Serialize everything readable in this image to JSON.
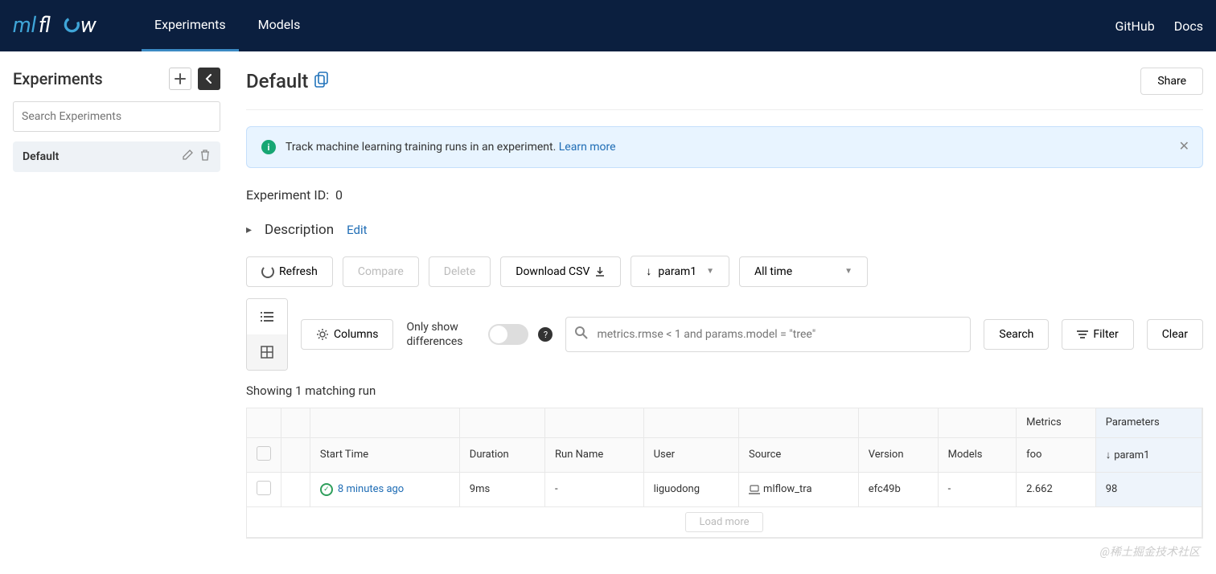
{
  "header": {
    "nav": {
      "experiments": "Experiments",
      "models": "Models"
    },
    "links": {
      "github": "GitHub",
      "docs": "Docs"
    }
  },
  "sidebar": {
    "title": "Experiments",
    "search_placeholder": "Search Experiments",
    "items": [
      {
        "name": "Default"
      }
    ]
  },
  "page": {
    "title": "Default",
    "share": "Share",
    "banner_text": "Track machine learning training runs in an experiment. ",
    "banner_link": "Learn more",
    "experiment_id_label": "Experiment ID:",
    "experiment_id_value": "0",
    "description_label": "Description",
    "edit": "Edit"
  },
  "toolbar": {
    "refresh": "Refresh",
    "compare": "Compare",
    "delete": "Delete",
    "download": "Download CSV",
    "sort_by": "param1",
    "timeframe": "All time"
  },
  "toolbar2": {
    "columns": "Columns",
    "diff_label": "Only show differences",
    "search_placeholder": "metrics.rmse < 1 and params.model = \"tree\"",
    "search": "Search",
    "filter": "Filter",
    "clear": "Clear"
  },
  "results": {
    "count_text": "Showing 1 matching run",
    "group_headers": {
      "metrics": "Metrics",
      "parameters": "Parameters"
    },
    "columns": {
      "start_time": "Start Time",
      "duration": "Duration",
      "run_name": "Run Name",
      "user": "User",
      "source": "Source",
      "version": "Version",
      "models": "Models",
      "foo": "foo",
      "param1": "param1"
    },
    "rows": [
      {
        "start_time": "8 minutes ago",
        "duration": "9ms",
        "run_name": "-",
        "user": "liguodong",
        "source": "mlflow_tra",
        "version": "efc49b",
        "models": "-",
        "foo": "2.662",
        "param1": "98"
      }
    ],
    "load_more": "Load more"
  },
  "watermark": "@稀土掘金技术社区"
}
